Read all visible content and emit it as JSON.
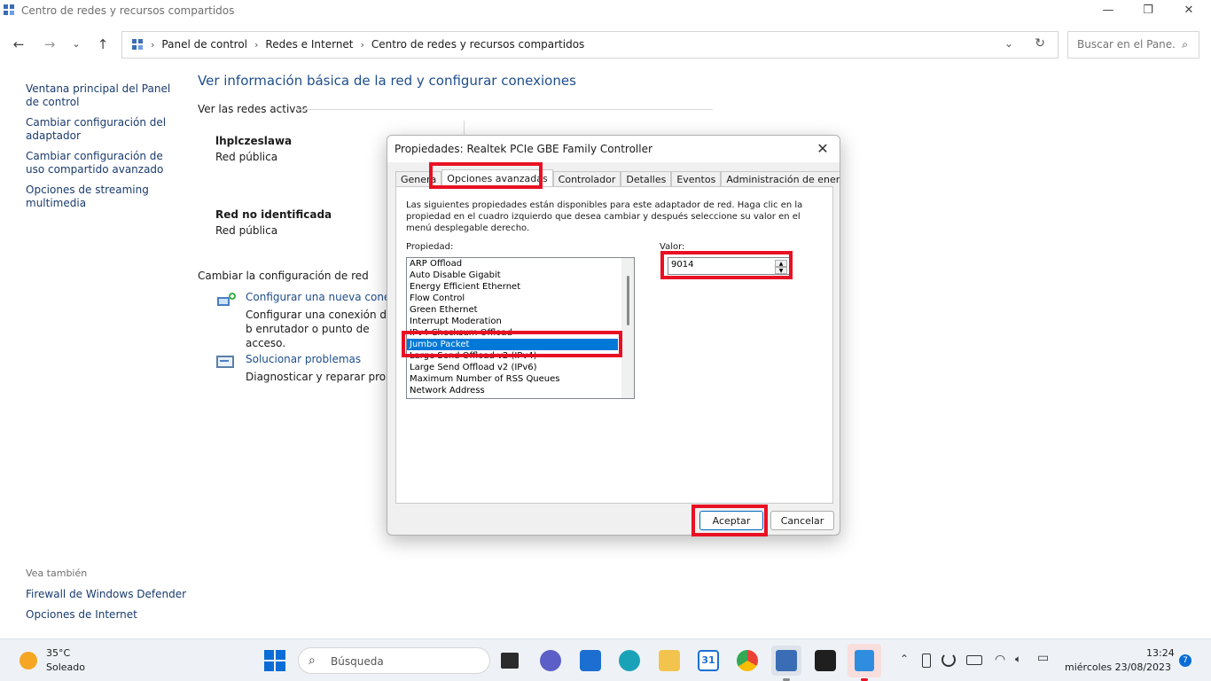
{
  "window": {
    "title": "Centro de redes y recursos compartidos",
    "controls": {
      "minimize": "—",
      "maximize": "❐",
      "close": "✕"
    }
  },
  "nav": {
    "back": "←",
    "forward": "→",
    "recent": "⌄",
    "up": "↑"
  },
  "address": {
    "crumbs": [
      "Panel de control",
      "Redes e Internet",
      "Centro de redes y recursos compartidos"
    ],
    "separator": "›",
    "dropdown": "⌄",
    "refresh": "↻"
  },
  "search": {
    "placeholder": "Buscar en el Pane...",
    "icon": "⌕"
  },
  "leftpane": {
    "links": [
      "Ventana principal del Panel de control",
      "Cambiar configuración del adaptador",
      "Cambiar configuración de uso compartido avanzado",
      "Opciones de streaming multimedia"
    ],
    "see_also_label": "Vea también",
    "see_also": [
      "Firewall de Windows Defender",
      "Opciones de Internet"
    ]
  },
  "main": {
    "title": "Ver información básica de la red y configurar conexiones",
    "active_networks_label": "Ver las redes activas",
    "networks": [
      {
        "name": "lhplczeslawa",
        "type": "Red pública"
      },
      {
        "name": "Red no identificada",
        "type": "Red pública"
      }
    ],
    "change_settings_label": "Cambiar la configuración de red",
    "tasks": [
      {
        "link": "Configurar una nueva conexión",
        "desc": "Configurar una conexión de b enrutador o punto de acceso."
      },
      {
        "link": "Solucionar problemas",
        "desc": "Diagnosticar y reparar problem"
      }
    ]
  },
  "dialog": {
    "title": "Propiedades: Realtek PCIe GBE Family Controller",
    "close": "✕",
    "tabs": [
      "Genera",
      "Opciones avanzadas",
      "Controlador",
      "Detalles",
      "Eventos",
      "Administración de energía"
    ],
    "active_tab": 1,
    "description": "Las siguientes propiedades están disponibles para este adaptador de red. Haga clic en la propiedad en el cuadro izquierdo que desea cambiar y después seleccione su valor en el menú desplegable derecho.",
    "property_label": "Propiedad:",
    "value_label": "Valor:",
    "properties": [
      "ARP Offload",
      "Auto Disable Gigabit",
      "Energy Efficient Ethernet",
      "Flow Control",
      "Green Ethernet",
      "Interrupt Moderation",
      "IPv4 Checksum Offload",
      "Jumbo Packet",
      "Large Send Offload v2 (IPv4)",
      "Large Send Offload v2 (IPv6)",
      "Maximum Number of RSS Queues",
      "Network Address"
    ],
    "selected_index": 7,
    "value": "9014",
    "spin_up": "▲",
    "spin_down": "▼",
    "ok_label": "Aceptar",
    "cancel_label": "Cancelar",
    "highlight_color": "#e81123"
  },
  "taskbar": {
    "weather_temp": "35°C",
    "weather_desc": "Soleado",
    "search_placeholder": "Búsqueda",
    "search_icon": "⌕",
    "calendar_day": "31",
    "tray_icons": {
      "chevron": "⌃",
      "wifi": "◠",
      "speaker": "🔈︎",
      "battery": "▭"
    },
    "time": "13:24",
    "date": "miércoles 23/08/2023",
    "notifications": "7",
    "accent": "#0a6cd6"
  }
}
